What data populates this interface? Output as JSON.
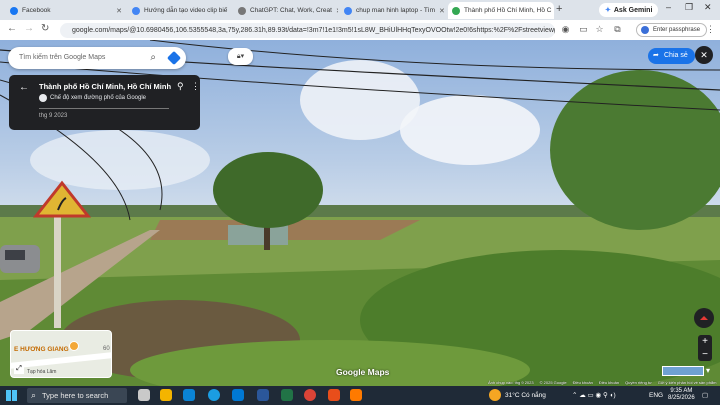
{
  "browser": {
    "tabs": [
      {
        "title": "Facebook",
        "active": false
      },
      {
        "title": "Hướng dẫn tạo video clip biế",
        "active": false
      },
      {
        "title": "ChatGPT: Chat, Work, Creat",
        "active": false
      },
      {
        "title": "chup man hinh laptop - Tìm",
        "active": false
      },
      {
        "title": "Thành phố Hồ Chí Minh, Hồ C",
        "active": true
      }
    ],
    "new_tab": "+",
    "ask_gemini": "Ask Gemini",
    "url": "google.com/maps/@10.6980456,106.5355548,3a,75y,286.31h,89.93t/data=!3m7!1e1!3m5!1sL8W_BHiUlHHqTexyOVOOtw!2e0!6shttps:%2F%2Fstreetviewpixels-pa.goo...",
    "passphrase_button": "Enter passphrase"
  },
  "maps": {
    "search_placeholder": "Tìm kiếm trên Google Maps",
    "card": {
      "title": "Thành phố Hồ Chí Minh, Hồ Chí Minh",
      "subtitle": "Chế độ xem đường phố của Google",
      "date": "thg 9 2023"
    },
    "share_label": "Chia sẻ",
    "minimap": {
      "place_label": "E HƯƠNG GIANG",
      "small_label": "Tạp hóa Lâm",
      "road_number": "60"
    },
    "logo": "Google Maps",
    "attribution": [
      "Ảnh chụp vào: thg 9 2023",
      "© 2025 Google",
      "Điều khoản",
      "Điều khoản",
      "Quyền riêng tư",
      "Gửi ý kiến phản hồi về sản phẩm"
    ]
  },
  "taskbar": {
    "search_placeholder": "Type here to search",
    "weather": "31°C  Có nắng",
    "language": "ENG",
    "time": "9:35 AM",
    "date": "8/25/2026"
  },
  "colors": {
    "accent": "#1a73e8",
    "card_bg": "#202124",
    "taskbar_bg": "#1f2a37"
  }
}
